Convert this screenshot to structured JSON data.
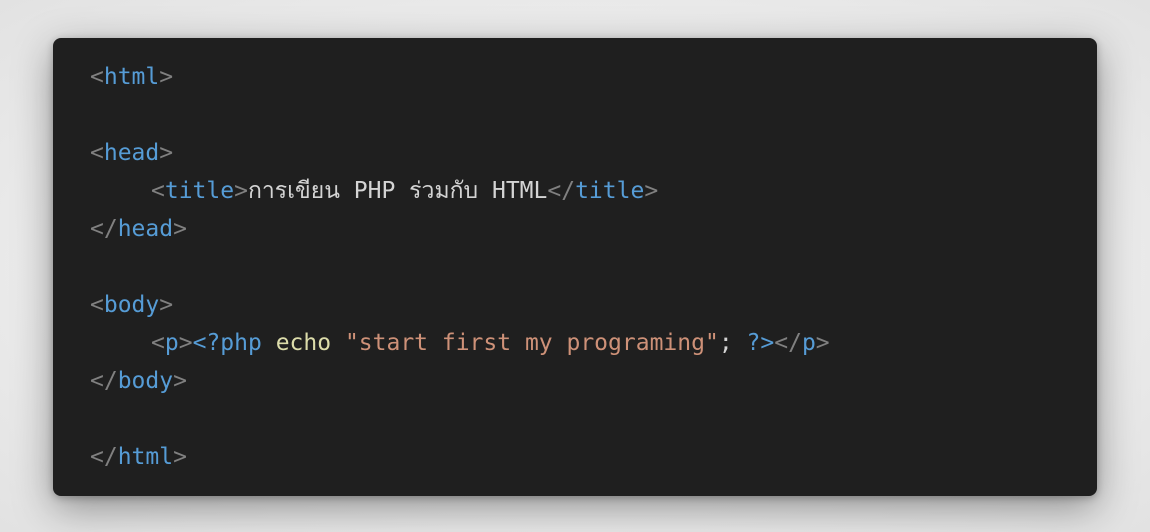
{
  "code": {
    "line1": {
      "lt": "<",
      "tag": "html",
      "gt": ">"
    },
    "line3": {
      "lt": "<",
      "tag": "head",
      "gt": ">"
    },
    "line4": {
      "open_lt": "<",
      "open_tag": "title",
      "open_gt": ">",
      "text": "การเขียน PHP ร่วมกับ HTML",
      "close_lt": "</",
      "close_tag": "title",
      "close_gt": ">"
    },
    "line5": {
      "lt": "</",
      "tag": "head",
      "gt": ">"
    },
    "line7": {
      "lt": "<",
      "tag": "body",
      "gt": ">"
    },
    "line8": {
      "open_lt": "<",
      "open_tag": "p",
      "open_gt": ">",
      "php_open": "<?php",
      "echo": "echo",
      "string": "\"start first my programing\"",
      "semicolon": ";",
      "php_close": "?>",
      "close_lt": "</",
      "close_tag": "p",
      "close_gt": ">"
    },
    "line9": {
      "lt": "</",
      "tag": "body",
      "gt": ">"
    },
    "line11": {
      "lt": "</",
      "tag": "html",
      "gt": ">"
    }
  },
  "colors": {
    "background": "#1f1f1f",
    "page": "#ececec",
    "punctuation": "#808080",
    "tag": "#569cd6",
    "text": "#d4d4d4",
    "keyword": "#dcdcaa",
    "string": "#ce9178"
  }
}
